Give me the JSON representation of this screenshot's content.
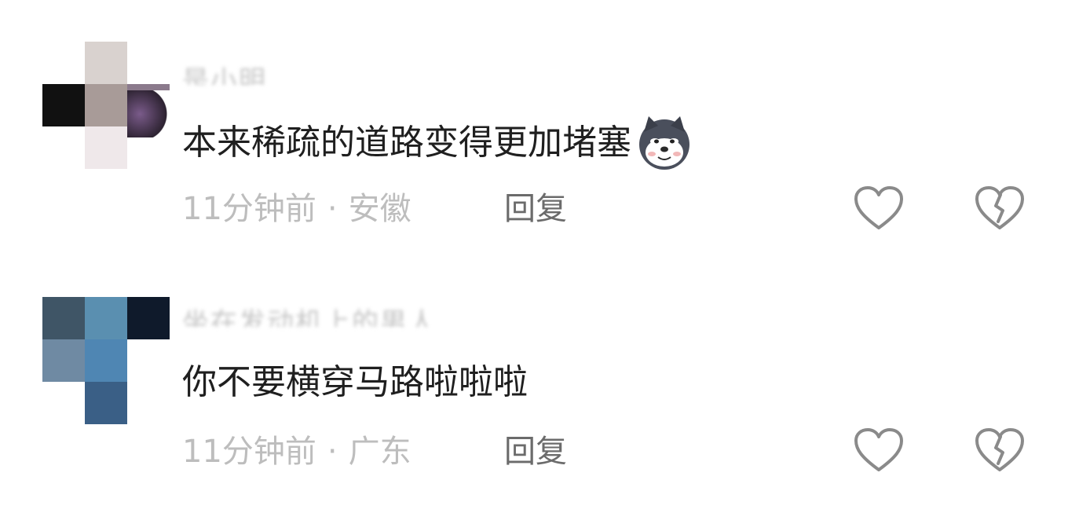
{
  "comments": [
    {
      "username": "是小明",
      "text": "本来稀疏的道路变得更加堵塞",
      "emoji": "doge-emoji",
      "time": "11分钟前",
      "separator": "·",
      "location": "安徽",
      "reply_label": "回复",
      "like_icon": "heart-outline-icon",
      "dislike_icon": "broken-heart-icon"
    },
    {
      "username": "坐在发动机上的男人",
      "text": "你不要横穿马路啦啦啦",
      "time": "11分钟前",
      "separator": "·",
      "location": "广东",
      "reply_label": "回复",
      "like_icon": "heart-outline-icon",
      "dislike_icon": "broken-heart-icon"
    }
  ],
  "colors": {
    "background": "#ffffff",
    "text": "#1f1f1f",
    "meta": "#bdbdbd",
    "reply": "#6b6b6b",
    "icon": "#8a8a8a"
  }
}
